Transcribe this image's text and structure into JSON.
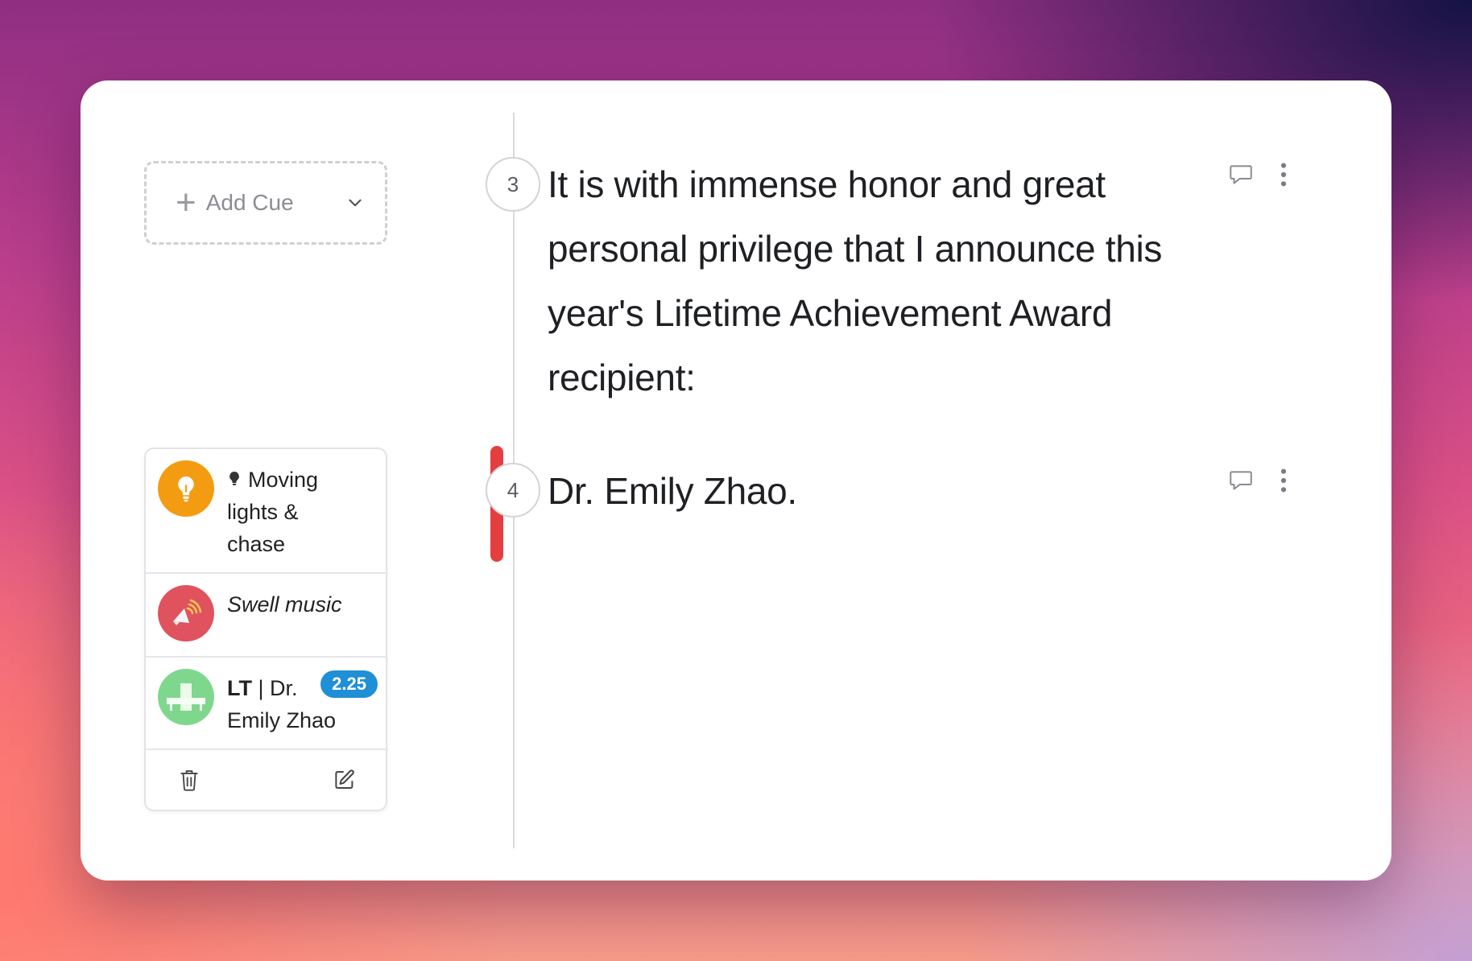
{
  "cue_panel": {
    "add_cue_label": "Add Cue"
  },
  "steps": [
    {
      "number": "3",
      "text_lines": [
        "It is with immense honor and great",
        "personal privilege that I announce this",
        "year's Lifetime Achievement Award",
        "recipient:"
      ]
    },
    {
      "number": "4",
      "text_lines": [
        "Dr. Emily Zhao."
      ]
    }
  ],
  "cues": {
    "lighting": {
      "line1": "Moving",
      "line2": "lights &",
      "line3": "chase",
      "icon": "lightbulb-icon",
      "color": "#f39c12"
    },
    "sound": {
      "label": "Swell music",
      "icon": "speaker-icon",
      "color": "#e0525e"
    },
    "lower_third": {
      "bold": "LT",
      "rest1": " | Dr.",
      "line2": "Emily Zhao",
      "badge": "2.25",
      "icon": "lower-third-icon",
      "color": "#7fd78e"
    }
  },
  "colors": {
    "accent_red": "#e53e3e",
    "badge_blue": "#1f8fd6"
  }
}
